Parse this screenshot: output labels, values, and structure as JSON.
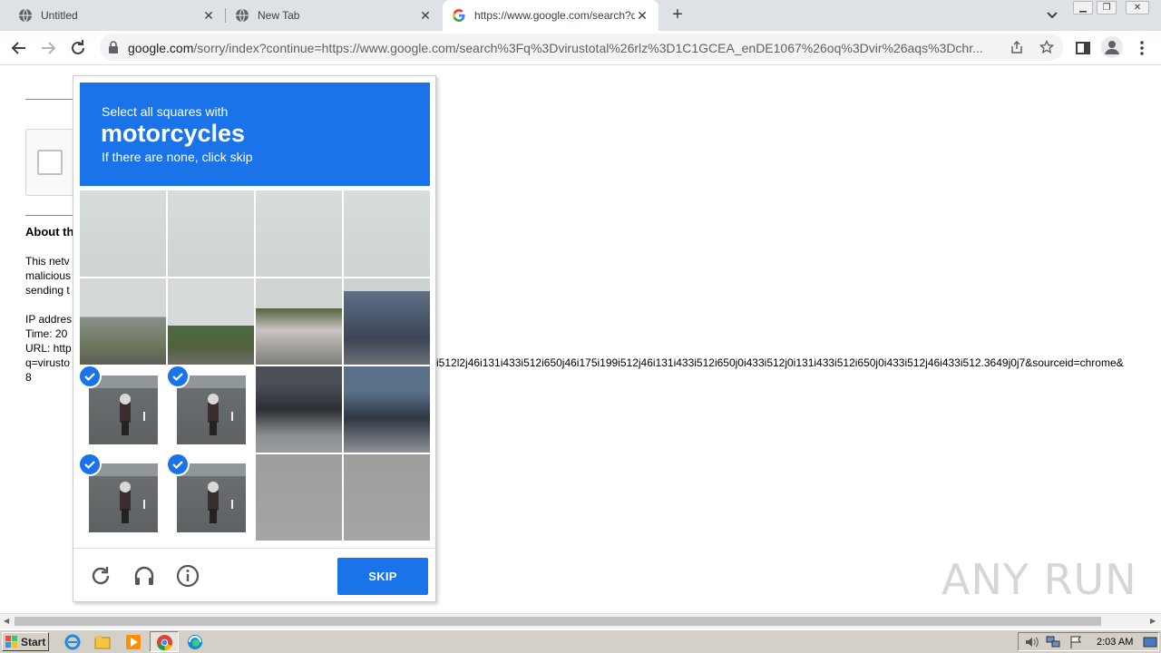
{
  "browser": {
    "tabs": [
      {
        "title": "Untitled",
        "active": false
      },
      {
        "title": "New Tab",
        "active": false
      },
      {
        "title": "https://www.google.com/search?q=vir",
        "active": true
      }
    ],
    "new_tab_label": "+",
    "url_host": "google.com",
    "url_rest": "/sorry/index?continue=https://www.google.com/search%3Fq%3Dvirustotal%26rlz%3D1C1GCEA_enDE1067%26oq%3Dvir%26aqs%3Dchr..."
  },
  "page": {
    "about_heading": "About th",
    "para": [
      "This netv",
      "malicious",
      "sending t"
    ],
    "ip_label": "IP addres",
    "time_label": "Time: 20",
    "url_label": "URL: http",
    "q_line_left": "q=virusto",
    "q_line_right": "i512l2j46i131i433i512i650j46i175i199i512j46i131i433i512i650j0i433i512j0i131i433i512i650j0i433i512j46i433i512.3649j0j7&sourceid=chrome&",
    "trailing": "8"
  },
  "captcha": {
    "line1": "Select all squares with",
    "keyword": "motorcycles",
    "line3": "If there are none, click skip",
    "selected_tiles": [
      8,
      9,
      12,
      13
    ],
    "skip_label": "SKIP",
    "footer_icons": [
      "reload-icon",
      "audio-icon",
      "info-icon"
    ]
  },
  "watermark": "ANY RUN",
  "taskbar": {
    "start_label": "Start",
    "clock": "2:03 AM"
  },
  "colors": {
    "accent": "#1a73e8",
    "tabstrip": "#dee1e6"
  }
}
